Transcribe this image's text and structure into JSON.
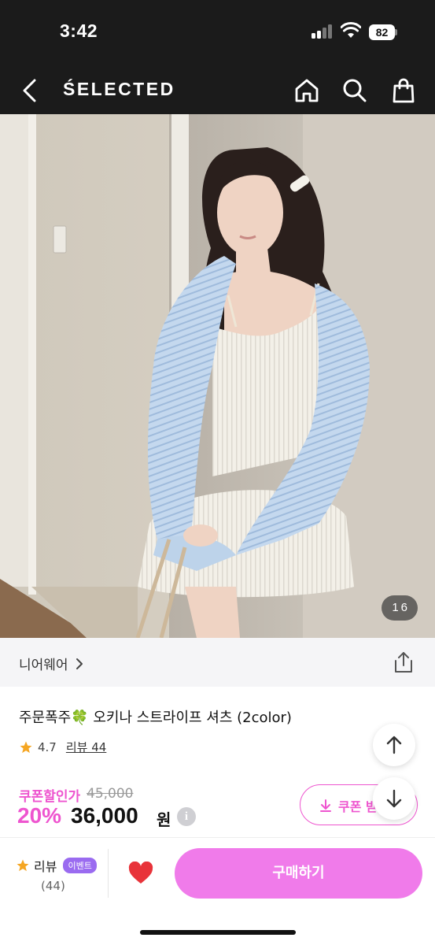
{
  "status_bar": {
    "time": "3:42",
    "battery": "82"
  },
  "header": {
    "brand": "ŚELECTED"
  },
  "image": {
    "counter": "1 6"
  },
  "product": {
    "brand_name": "니어웨어",
    "title": "주문폭주🍀 오키나 스트라이프 셔츠 (2color)",
    "rating": "4.7",
    "review_label": "리뷰 44"
  },
  "price": {
    "coupon_label": "쿠폰할인가",
    "original": "45,000",
    "discount": "20%",
    "final": "36,000",
    "currency": "원",
    "info": "i",
    "coupon_button": "쿠폰 받"
  },
  "bottom_bar": {
    "review_label": "리뷰",
    "event_badge": "이벤트",
    "review_count": "(44)",
    "buy_button": "구매하기"
  },
  "colors": {
    "accent": "#ee55cf",
    "buy": "#f07bea",
    "heart": "#e8333a",
    "star": "#f5a623"
  }
}
